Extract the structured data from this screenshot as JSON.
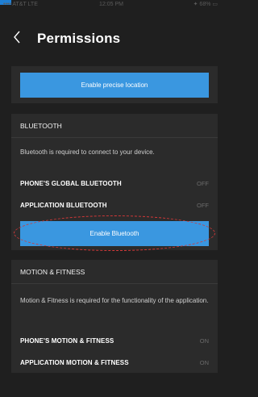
{
  "status_bar": {
    "carrier": "•••• AT&T LTE",
    "time": "12:05 PM",
    "battery": "✦ 68% ▭"
  },
  "nav": {
    "back_icon": "chevron-left-icon",
    "title": "Permissions"
  },
  "location_section": {
    "button_label": "Enable precise location"
  },
  "bluetooth_section": {
    "title": "BLUETOOTH",
    "description": "Bluetooth is required to connect to your device.",
    "rows": [
      {
        "label": "PHONE'S GLOBAL BLUETOOTH",
        "value": "OFF"
      },
      {
        "label": "APPLICATION BLUETOOTH",
        "value": "OFF"
      }
    ],
    "button_label": "Enable Bluetooth"
  },
  "motion_section": {
    "title": "MOTION & FITNESS",
    "description": "Motion & Fitness is required for the functionality of the application.",
    "rows": [
      {
        "label": "PHONE'S MOTION & FITNESS",
        "value": "ON"
      },
      {
        "label": "APPLICATION MOTION & FITNESS",
        "value": "ON"
      }
    ]
  },
  "colors": {
    "background": "#1f1f1f",
    "card": "#2b2b2b",
    "accent_button": "#3a97e0",
    "highlight_ring": "#d23838"
  }
}
